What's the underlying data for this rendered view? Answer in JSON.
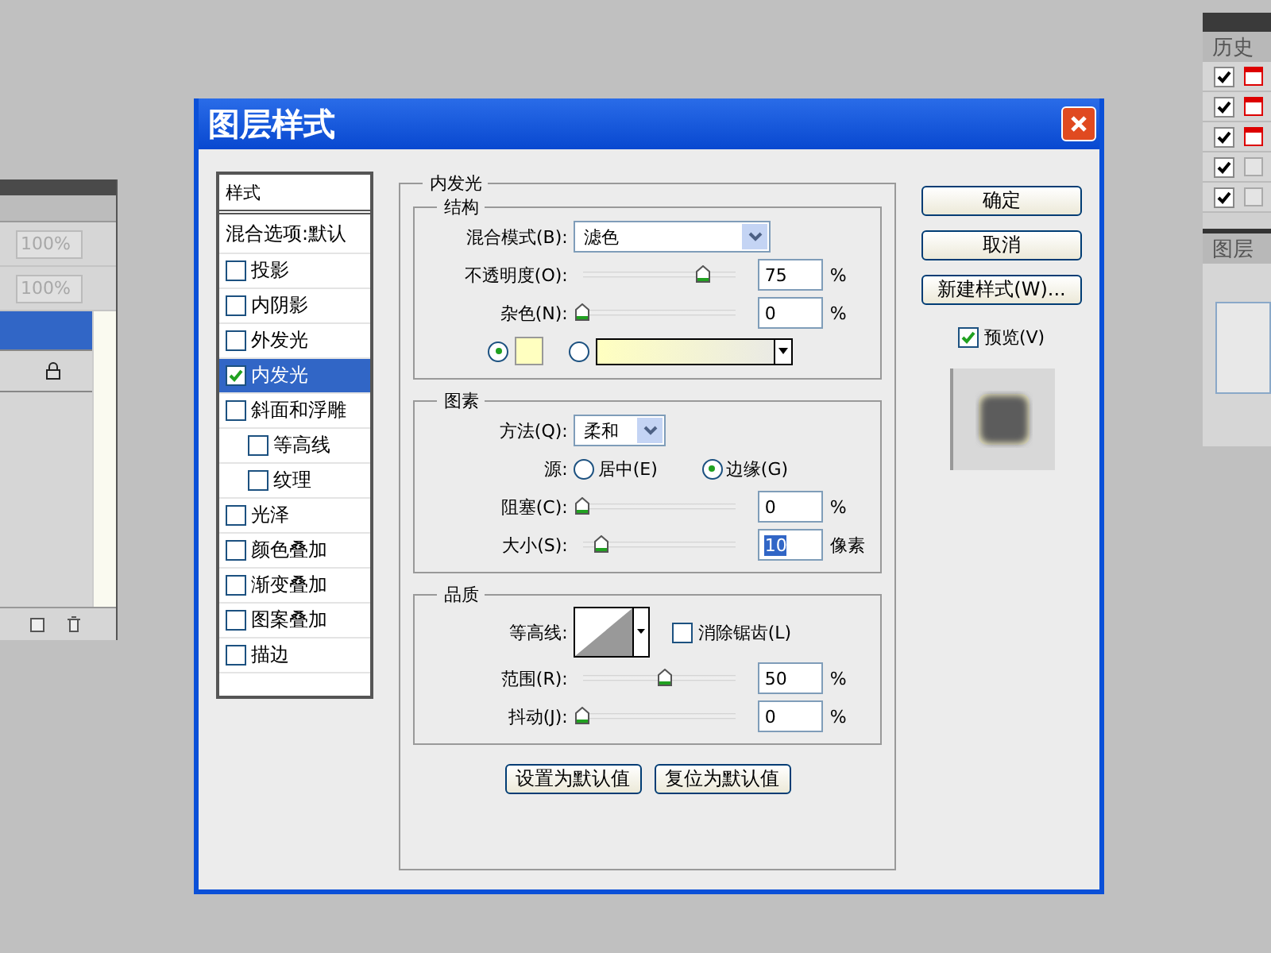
{
  "left_panel": {
    "fields": [
      {
        "value": "100%",
        "disabled": true
      },
      {
        "value": "100%",
        "disabled": true
      }
    ],
    "rows": [
      {
        "selected": true,
        "locked": false
      },
      {
        "selected": false,
        "locked": true
      }
    ]
  },
  "right_panel": {
    "history_title": "历史",
    "history_rows": [
      {
        "checked": true,
        "kind": "snapshot"
      },
      {
        "checked": true,
        "kind": "snapshot"
      },
      {
        "checked": true,
        "kind": "snapshot"
      },
      {
        "checked": true,
        "kind": "blank"
      },
      {
        "checked": true,
        "kind": "blank"
      }
    ],
    "comps_title": "图层"
  },
  "dialog": {
    "title": "图层样式",
    "style_list": {
      "header": "样式",
      "blend_options": "混合选项:默认",
      "items": [
        {
          "label": "投影",
          "checked": false,
          "selected": false
        },
        {
          "label": "内阴影",
          "checked": false,
          "selected": false
        },
        {
          "label": "外发光",
          "checked": false,
          "selected": false
        },
        {
          "label": "内发光",
          "checked": true,
          "selected": true
        },
        {
          "label": "斜面和浮雕",
          "checked": false,
          "selected": false,
          "children": [
            {
              "label": "等高线",
              "checked": false,
              "selected": false
            },
            {
              "label": "纹理",
              "checked": false,
              "selected": false
            }
          ]
        },
        {
          "label": "光泽",
          "checked": false,
          "selected": false
        },
        {
          "label": "颜色叠加",
          "checked": false,
          "selected": false
        },
        {
          "label": "渐变叠加",
          "checked": false,
          "selected": false
        },
        {
          "label": "图案叠加",
          "checked": false,
          "selected": false
        },
        {
          "label": "描边",
          "checked": false,
          "selected": false
        }
      ]
    },
    "panel_title": "内发光",
    "structure": {
      "title": "结构",
      "blend_mode": {
        "label": "混合模式(B):",
        "value": "滤色"
      },
      "sliders": [
        {
          "label": "不透明度(O):",
          "level": 0.78,
          "value": "75",
          "unit": "%"
        },
        {
          "label": "杂色(N):",
          "level": 0,
          "value": "0",
          "unit": "%"
        }
      ],
      "fill_options": [
        {
          "kind": "swatch",
          "selected": true,
          "color": "#ffffc0"
        },
        {
          "kind": "gradient",
          "selected": false,
          "color": "#ffffc0"
        }
      ]
    },
    "elements": {
      "title": "图素",
      "technique": {
        "label": "方法(Q):",
        "value": "柔和"
      },
      "source": {
        "label": "源:",
        "options": [
          {
            "label": "居中(E)",
            "selected": false
          },
          {
            "label": "边缘(G)",
            "selected": true
          }
        ]
      },
      "sliders": [
        {
          "label": "阻塞(C):",
          "level": 0,
          "value": "0",
          "unit": "%"
        },
        {
          "label": "大小(S):",
          "level": 0.12,
          "value": "10",
          "unit": "像素"
        }
      ]
    },
    "quality": {
      "title": "品质",
      "contour_label": "等高线:",
      "anti_alias": {
        "label": "消除锯齿(L)",
        "checked": false
      },
      "sliders": [
        {
          "label": "范围(R):",
          "level": 0.53,
          "value": "50",
          "unit": "%"
        },
        {
          "label": "抖动(J):",
          "level": 0,
          "value": "0",
          "unit": "%"
        }
      ]
    },
    "bottom_buttons": [
      "设置为默认值",
      "复位为默认值"
    ],
    "side_buttons": [
      "确定",
      "取消",
      "新建样式(W)..."
    ],
    "preview": {
      "label": "预览(V)",
      "checked": true
    }
  }
}
